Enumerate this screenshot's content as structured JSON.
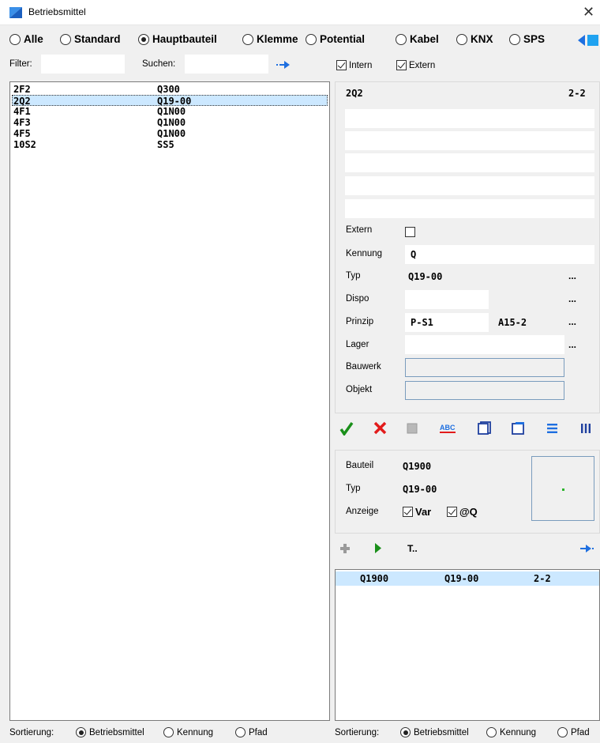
{
  "window": {
    "title": "Betriebsmittel"
  },
  "type_radios": [
    {
      "label": "Alle",
      "checked": false
    },
    {
      "label": "Standard",
      "checked": false
    },
    {
      "label": "Hauptbauteil",
      "checked": true
    },
    {
      "label": "Klemme",
      "checked": false
    },
    {
      "label": "Potential",
      "checked": false
    },
    {
      "label": "Kabel",
      "checked": false
    },
    {
      "label": "KNX",
      "checked": false
    },
    {
      "label": "SPS",
      "checked": false
    }
  ],
  "filter": {
    "filter_label": "Filter:",
    "filter_value": "",
    "search_label": "Suchen:",
    "search_value": ""
  },
  "toggles": {
    "intern_label": "Intern",
    "intern_checked": true,
    "extern_label": "Extern",
    "extern_checked": true
  },
  "left_list": [
    {
      "name": "2F2",
      "value": "Q300",
      "selected": false
    },
    {
      "name": "2Q2",
      "value": "Q19-00",
      "selected": true
    },
    {
      "name": "4F1",
      "value": "Q1N00",
      "selected": false
    },
    {
      "name": "4F3",
      "value": "Q1N00",
      "selected": false
    },
    {
      "name": "4F5",
      "value": "Q1N00",
      "selected": false
    },
    {
      "name": "10S2",
      "value": "SS5",
      "selected": false
    }
  ],
  "detail": {
    "header_name": "2Q2",
    "header_page": "2-2",
    "extern_label": "Extern",
    "kennung_label": "Kennung",
    "kennung_value": "Q",
    "typ_label": "Typ",
    "typ_value": "Q19-00",
    "dispo_label": "Dispo",
    "dispo_value": "",
    "prinzip_label": "Prinzip",
    "prinzip_value": "P-S1",
    "prinzip_ref": "A15-2",
    "lager_label": "Lager",
    "lager_value": "",
    "bauwerk_label": "Bauwerk",
    "objekt_label": "Objekt",
    "more_button": "..."
  },
  "toolbar_icons": {
    "abc_label": "ABC"
  },
  "part_info": {
    "bauteil_label": "Bauteil",
    "bauteil_value": "Q1900",
    "typ_label": "Typ",
    "typ_value": "Q19-00",
    "anzeige_label": "Anzeige",
    "var_label": "Var",
    "var_checked": true,
    "q_label": "@Q",
    "q_checked": true
  },
  "sub_toolbar": {
    "t_label": "T.."
  },
  "right_list": [
    {
      "col1": "Q1900",
      "col2": "Q19-00",
      "col3": "2-2"
    }
  ],
  "sort_left": {
    "label": "Sortierung:",
    "options": [
      "Betriebsmittel",
      "Kennung",
      "Pfad"
    ],
    "selected": 0
  },
  "sort_right": {
    "label": "Sortierung:",
    "options": [
      "Betriebsmittel",
      "Kennung",
      "Pfad"
    ],
    "selected": 0
  },
  "colors": {
    "accent_blue": "#1e6fe0",
    "check_green": "#1a8f1a",
    "cross_red": "#e21b1b",
    "selection": "#cce8ff"
  }
}
